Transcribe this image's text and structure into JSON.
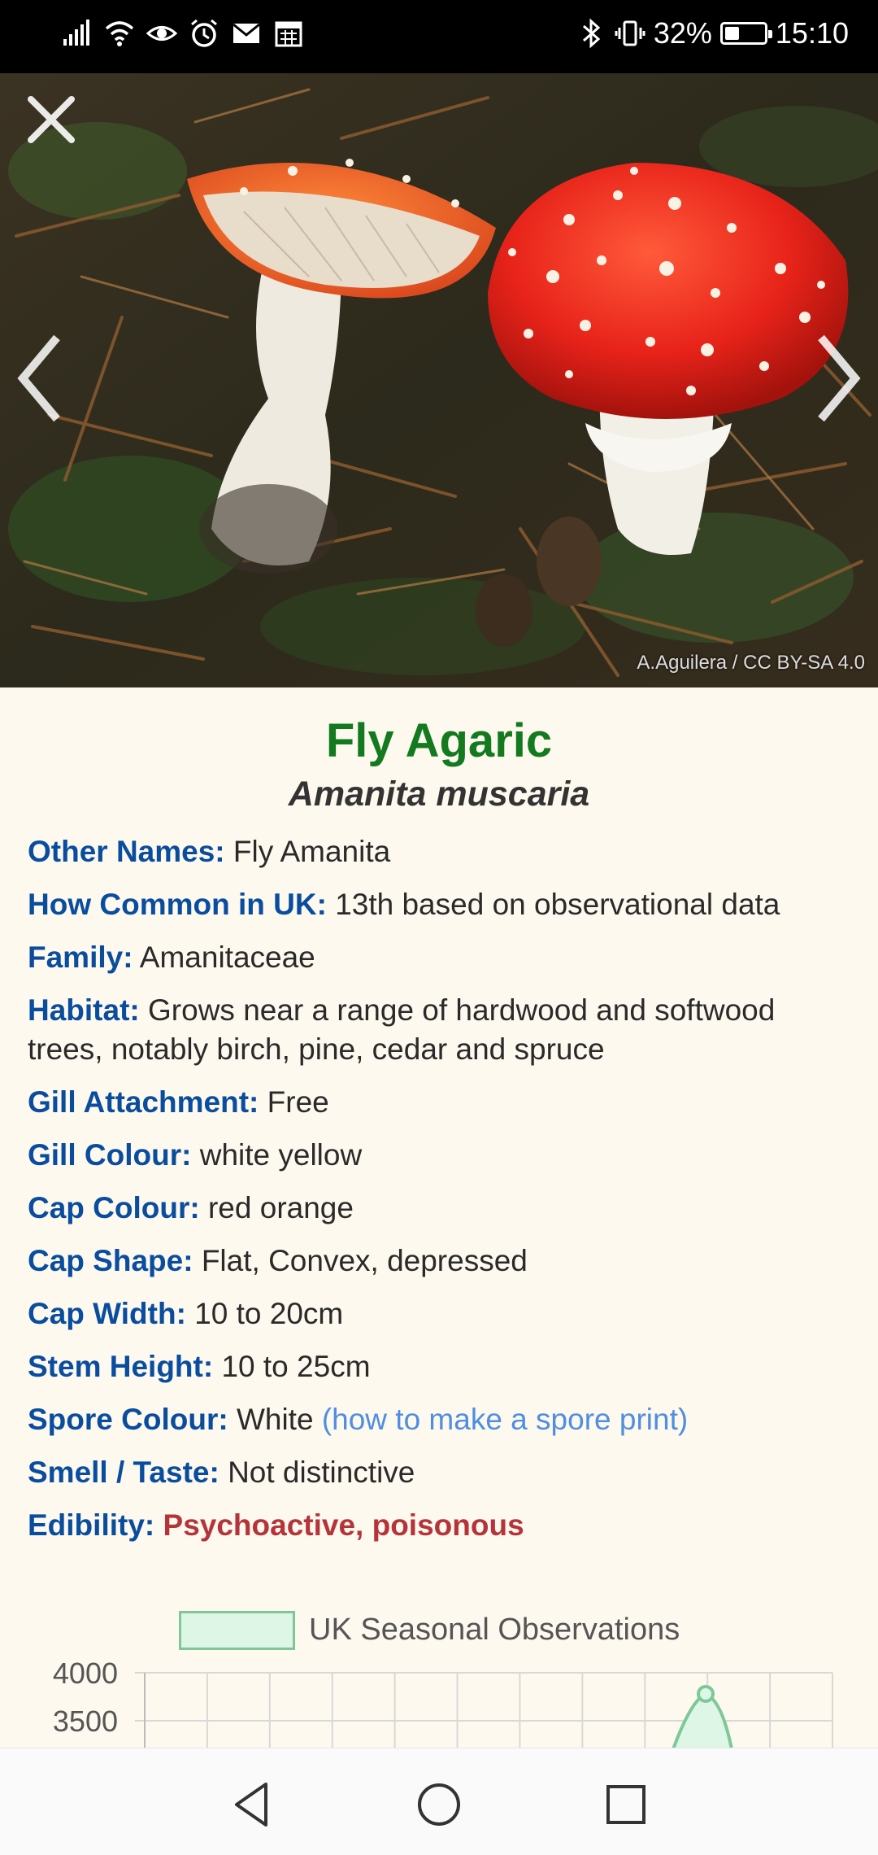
{
  "status_bar": {
    "battery_percent": "32%",
    "battery_level": 0.32,
    "time": "15:10",
    "left_icons": [
      "signal-icon",
      "wifi-icon",
      "eye-icon",
      "alarm-icon",
      "mail-icon",
      "calendar-icon"
    ],
    "right_icons": [
      "bluetooth-icon",
      "vibrate-icon"
    ]
  },
  "hero": {
    "credit": "A.Aguilera / CC BY-SA 4.0",
    "icons": {
      "close": "close-icon",
      "prev": "chevron-left-icon",
      "next": "chevron-right-icon"
    }
  },
  "species": {
    "common_name": "Fly Agaric",
    "latin_name": "Amanita muscaria"
  },
  "facts": [
    {
      "label": "Other Names:",
      "value": "Fly Amanita"
    },
    {
      "label": "How Common in UK:",
      "value": "13th based on observational data"
    },
    {
      "label": "Family:",
      "value": "Amanitaceae"
    },
    {
      "label": "Habitat:",
      "value": "Grows near a range of hardwood and softwood trees, notably birch, pine, cedar and spruce"
    },
    {
      "label": "Gill Attachment:",
      "value": "Free"
    },
    {
      "label": "Gill Colour:",
      "value": "white yellow"
    },
    {
      "label": "Cap Colour:",
      "value": "red orange"
    },
    {
      "label": "Cap Shape:",
      "value": "Flat, Convex, depressed"
    },
    {
      "label": "Cap Width:",
      "value": "10 to 20cm"
    },
    {
      "label": "Stem Height:",
      "value": "10 to 25cm"
    },
    {
      "label": "Spore Colour:",
      "value": "White",
      "link": "(how to make a spore print)"
    },
    {
      "label": "Smell / Taste:",
      "value": "Not distinctive"
    },
    {
      "label": "Edibility:",
      "value": "Psychoactive, poisonous",
      "danger": true
    }
  ],
  "chart_data": {
    "type": "area",
    "title": "",
    "legend": [
      "UK Seasonal Observations"
    ],
    "legend_placement": "top",
    "y_ticks": [
      4000,
      3500
    ],
    "grid": true,
    "colors": {
      "fill": "#ddf6e5",
      "stroke": "#7ec898"
    }
  },
  "nav_bar": {
    "icons": [
      "back-icon",
      "home-icon",
      "recents-icon"
    ]
  },
  "colors": {
    "common_name": "#137a1f",
    "label": "#0a4d9e",
    "link": "#4f8ee0",
    "danger": "#b5343a",
    "background": "#fdf9ee"
  }
}
